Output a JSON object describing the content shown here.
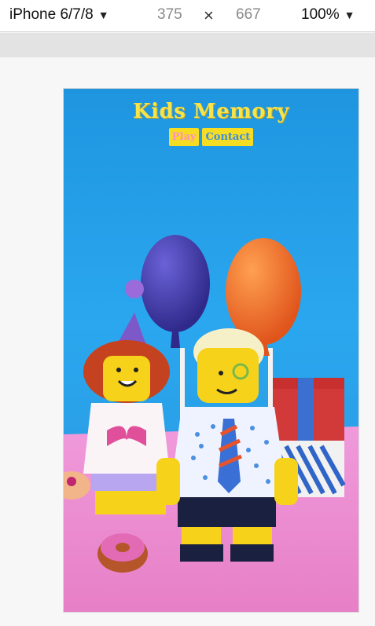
{
  "devtools": {
    "device": "iPhone 6/7/8",
    "width": "375",
    "times": "×",
    "height": "667",
    "zoom": "100%"
  },
  "site": {
    "title": "Kids Memory",
    "nav": [
      {
        "label": "Play"
      },
      {
        "label": "Contact"
      }
    ]
  },
  "colors": {
    "sky": "#2aa7ef",
    "floor": "#ee8ad0",
    "title": "#f7e34a",
    "nav_bg": "#f6dc22",
    "play_text": "#ff8fc4",
    "contact_text": "#3a8ee0"
  }
}
